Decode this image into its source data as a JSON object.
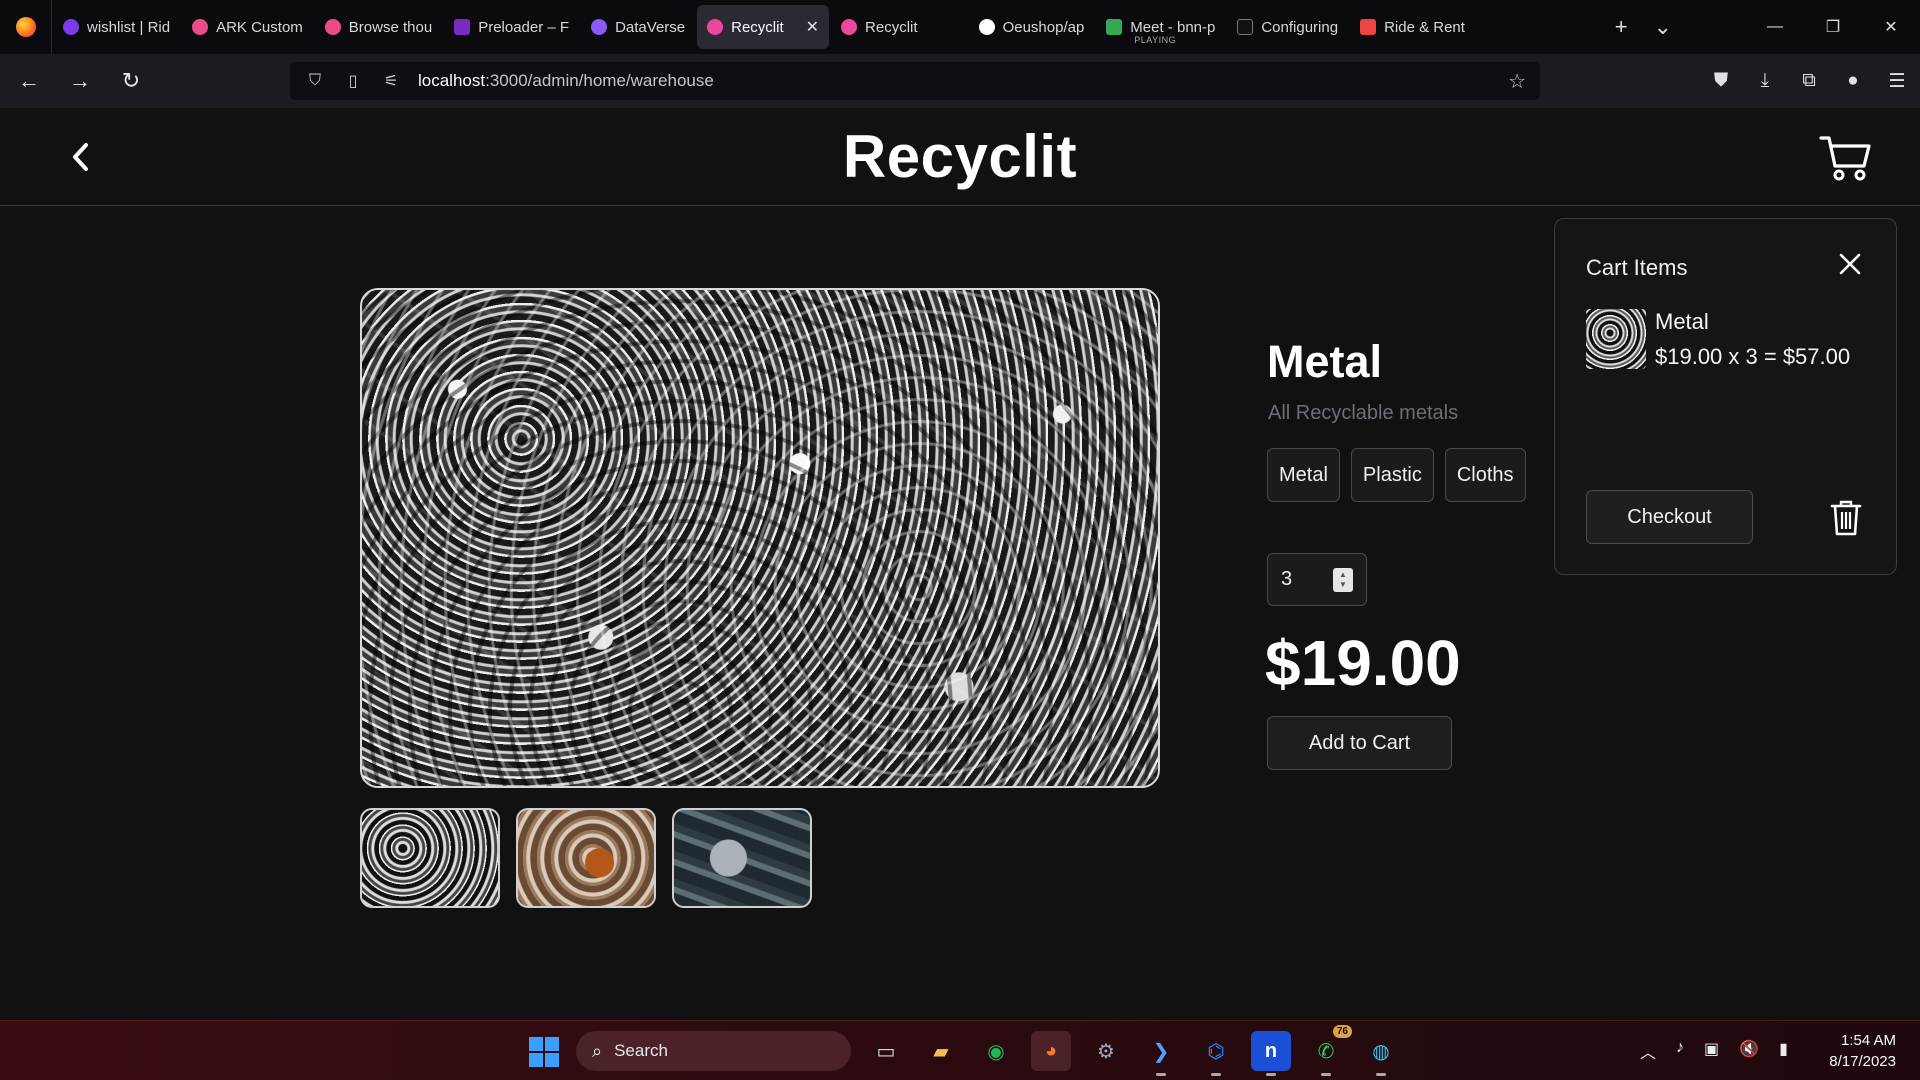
{
  "browser": {
    "tabs": [
      {
        "title": "wishlist | Rid",
        "favicon_color": "#7c3aed"
      },
      {
        "title": "ARK Custom",
        "favicon_color": "#ea4c89"
      },
      {
        "title": "Browse thou",
        "favicon_color": "#ea4c89"
      },
      {
        "title": "Preloader – F",
        "favicon_color": "#7b2cbf"
      },
      {
        "title": "DataVerse",
        "favicon_color": "#8a5cf6"
      },
      {
        "title": "Recyclit",
        "favicon_color": "#ec4899",
        "active": true
      },
      {
        "title": "Recyclit",
        "favicon_color": "#ec4899"
      },
      {
        "title": "Oeushop/ap",
        "favicon_color": "#ffffff"
      },
      {
        "title": "Meet - bnn-p",
        "favicon_color": "#34a853",
        "subtitle": "PLAYING"
      },
      {
        "title": "Configuring",
        "favicon_color": "#111111"
      },
      {
        "title": "Ride & Rent",
        "favicon_color": "#ef4444"
      }
    ],
    "url_host": "localhost",
    "url_path": ":3000/admin/home/warehouse"
  },
  "app": {
    "brand": "Recyclit"
  },
  "product": {
    "title": "Metal",
    "subtitle": "All Recyclable metals",
    "categories": [
      "Metal",
      "Plastic",
      "Cloths"
    ],
    "quantity": "3",
    "price": "$19.00",
    "add_to_cart_label": "Add to Cart"
  },
  "cart": {
    "heading": "Cart Items",
    "item_name": "Metal",
    "item_line": "$19.00 x 3 = $57.00",
    "checkout_label": "Checkout"
  },
  "taskbar": {
    "search_label": "Search",
    "whatsapp_badge": "76",
    "time": "1:54 AM",
    "date": "8/17/2023"
  },
  "colors": {
    "background": "#111111",
    "accent_text": "#ffffff",
    "muted_text": "#6e6e78",
    "border": "#4a4a4a"
  }
}
